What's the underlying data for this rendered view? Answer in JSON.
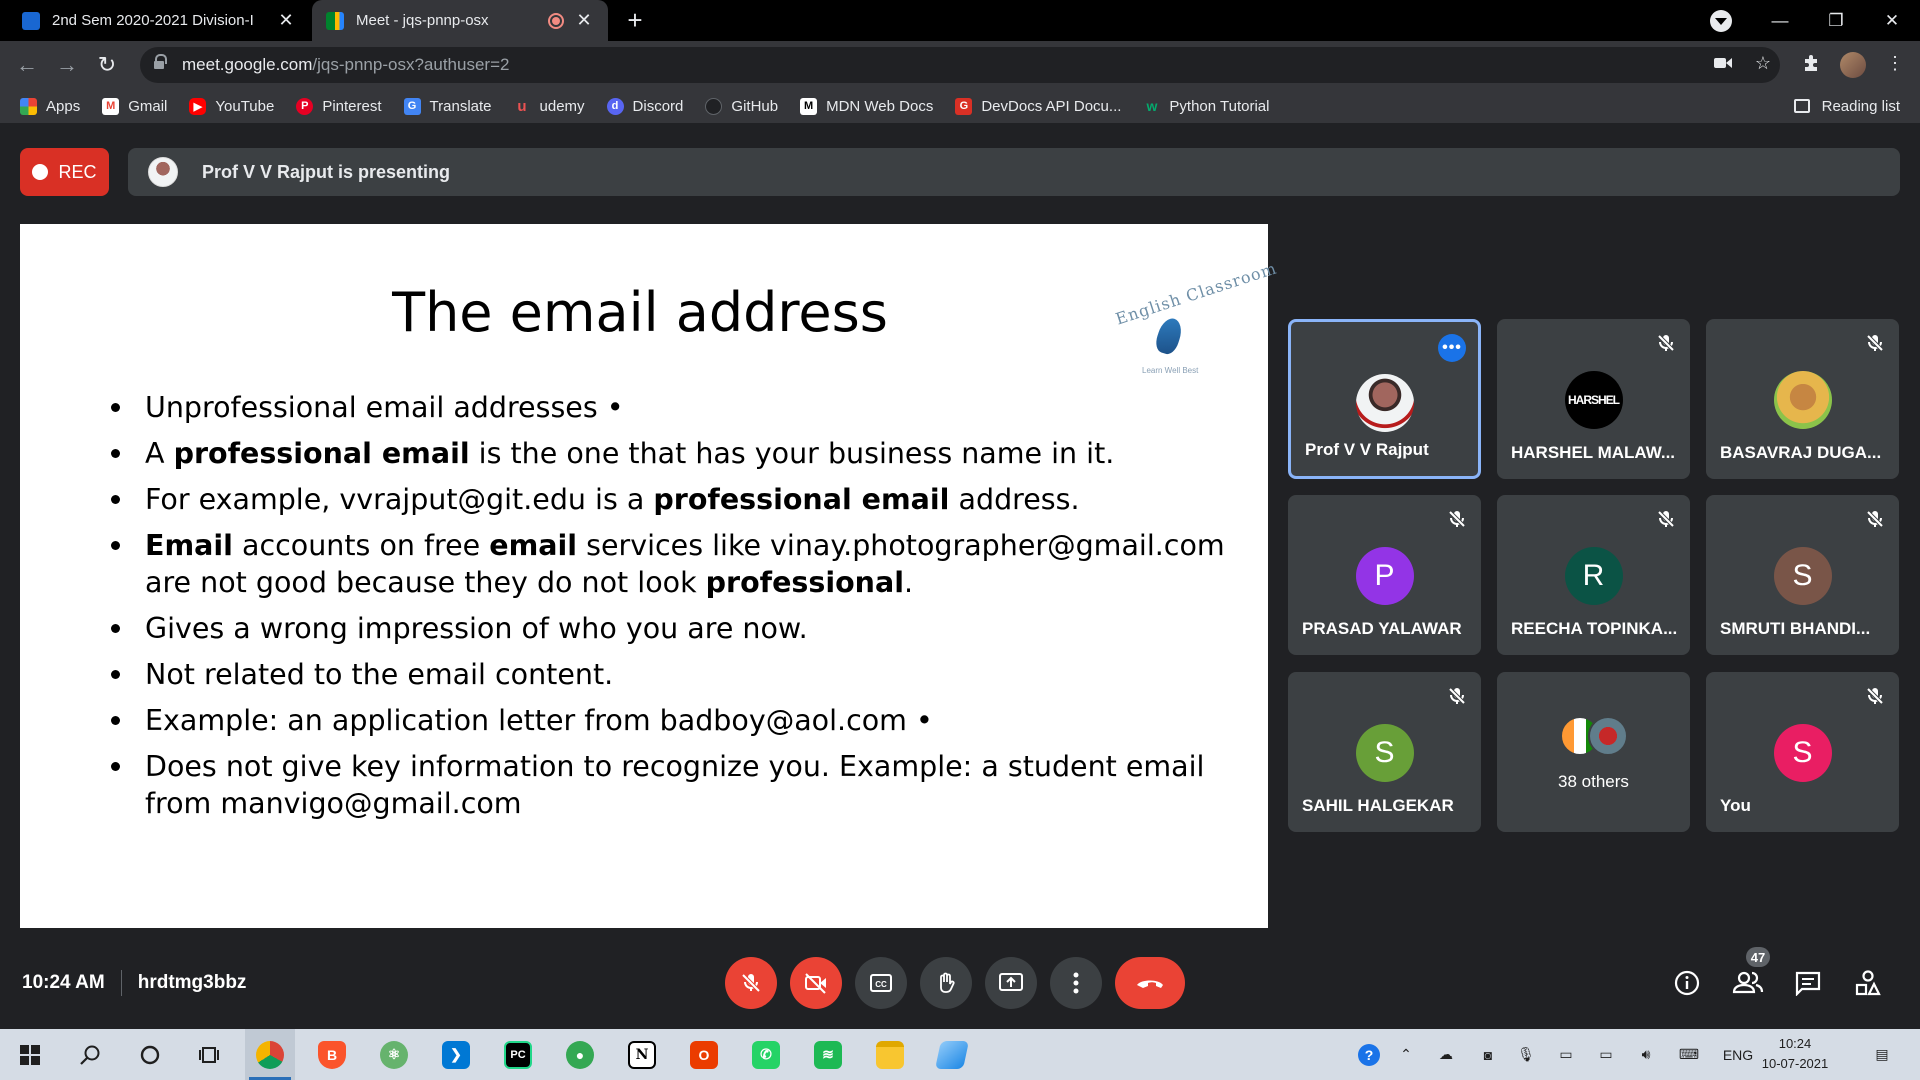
{
  "browser": {
    "tabs": [
      {
        "title": "2nd Sem 2020-2021 Division-I",
        "active": false,
        "favicon_color": "#1967d2"
      },
      {
        "title": "Meet - jqs-pnnp-osx",
        "active": true,
        "favicon_color": "#00832d"
      }
    ],
    "address": {
      "host": "meet.google.com",
      "path": "/jqs-pnnp-osx?authuser=2"
    },
    "bookmarks": [
      {
        "label": "Apps",
        "icon": "apps-grid-icon",
        "color": "#4285f4"
      },
      {
        "label": "Gmail",
        "icon": "gmail-icon",
        "color": "#ea4335"
      },
      {
        "label": "YouTube",
        "icon": "youtube-icon",
        "color": "#ff0000"
      },
      {
        "label": "Pinterest",
        "icon": "pinterest-icon",
        "color": "#e60023"
      },
      {
        "label": "Translate",
        "icon": "translate-icon",
        "color": "#4285f4"
      },
      {
        "label": "udemy",
        "icon": "udemy-icon",
        "color": "#a435f0"
      },
      {
        "label": "Discord",
        "icon": "discord-icon",
        "color": "#5865f2"
      },
      {
        "label": "GitHub",
        "icon": "github-icon",
        "color": "#202124"
      },
      {
        "label": "MDN Web Docs",
        "icon": "mdn-icon",
        "color": "#ffffff"
      },
      {
        "label": "DevDocs API Docu...",
        "icon": "devdocs-icon",
        "color": "#d93025"
      },
      {
        "label": "Python Tutorial",
        "icon": "w3schools-icon",
        "color": "#04aa6d"
      }
    ],
    "reading_list": "Reading list"
  },
  "meet": {
    "rec_label": "REC",
    "presenting_text": "Prof V V Rajput is presenting",
    "slide": {
      "title": "The email address",
      "logo_text": "English Classroom",
      "logo_sub": "Learn Well Best",
      "bullets": [
        [
          {
            "t": "Unprofessional email addresses •",
            "b": false
          }
        ],
        [
          {
            "t": "A ",
            "b": false
          },
          {
            "t": "professional email",
            "b": true
          },
          {
            "t": " is the one that has your business name in it.",
            "b": false
          }
        ],
        [
          {
            "t": "For example, vvrajput@git.edu is a ",
            "b": false
          },
          {
            "t": "professional email",
            "b": true
          },
          {
            "t": " address.",
            "b": false
          }
        ],
        [
          {
            "t": "Email",
            "b": true
          },
          {
            "t": " accounts on free ",
            "b": false
          },
          {
            "t": "email",
            "b": true
          },
          {
            "t": " services like vinay.photographer@gmail.com are not good because they do not look ",
            "b": false
          },
          {
            "t": "professional",
            "b": true
          },
          {
            "t": ".",
            "b": false
          }
        ],
        [
          {
            "t": "Gives a wrong impression of who you are now.",
            "b": false
          }
        ],
        [
          {
            "t": "Not related to the email content.",
            "b": false
          }
        ],
        [
          {
            "t": "Example: an application letter from badboy@aol.com •",
            "b": false
          }
        ],
        [
          {
            "t": "Does not give key information to recognize you. Example: a student email from manvigo@gmail.com",
            "b": false
          }
        ]
      ]
    },
    "participants": [
      {
        "name": "Prof V V Rajput",
        "initial": "",
        "avatar_color": "#f1f3f4",
        "muted": false,
        "active": true
      },
      {
        "name": "HARSHEL MALAW...",
        "initial": "HARSHEL",
        "avatar_color": "#000000",
        "muted": true,
        "active": false
      },
      {
        "name": "BASAVRAJ DUGA...",
        "initial": "",
        "avatar_color": "#d9a441",
        "muted": true,
        "active": false
      },
      {
        "name": "PRASAD YALAWAR",
        "initial": "P",
        "avatar_color": "#9334e6",
        "muted": true,
        "active": false
      },
      {
        "name": "REECHA TOPINKA...",
        "initial": "R",
        "avatar_color": "#0b5345",
        "muted": true,
        "active": false
      },
      {
        "name": "SMRUTI BHANDI...",
        "initial": "S",
        "avatar_color": "#795548",
        "muted": true,
        "active": false
      },
      {
        "name": "SAHIL HALGEKAR",
        "initial": "S",
        "avatar_color": "#689f38",
        "muted": true,
        "active": false
      },
      {
        "name": "38 others",
        "initial": "",
        "avatar_color": "#5f6368",
        "muted": false,
        "active": false
      },
      {
        "name": "You",
        "initial": "S",
        "avatar_color": "#e91e63",
        "muted": true,
        "active": false
      }
    ],
    "time": "10:24 AM",
    "meeting_code": "hrdtmg3bbz",
    "people_count": "47"
  },
  "taskbar": {
    "apps": [
      "chrome-icon",
      "brave-icon",
      "atom-icon",
      "vscode-icon",
      "pycharm-icon",
      "maps-icon",
      "notion-icon",
      "office-icon",
      "whatsapp-icon",
      "spotify-icon",
      "file-explorer-icon",
      "photos-icon"
    ],
    "language": "ENG",
    "clock_time": "10:24",
    "clock_date": "10-07-2021"
  }
}
